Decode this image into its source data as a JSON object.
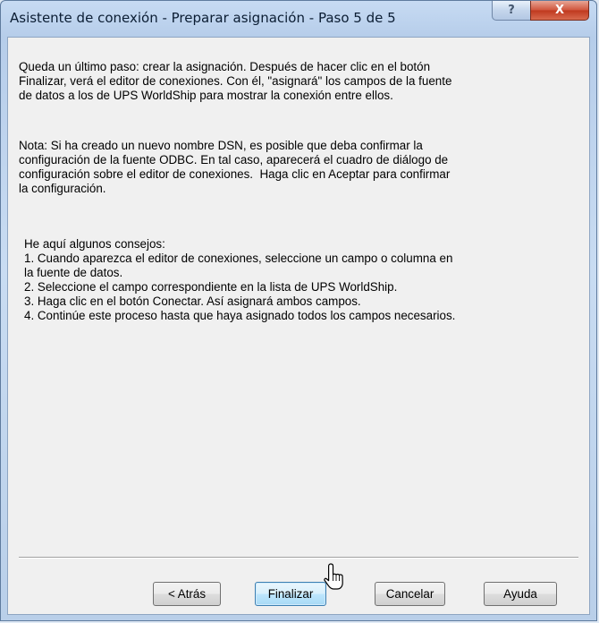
{
  "window": {
    "title": "Asistente de conexión - Preparar asignación - Paso 5 de 5",
    "help_button": "?",
    "close_button": "X"
  },
  "content": {
    "paragraph1": "Queda un último paso: crear la asignación. Después de hacer clic en el botón\nFinalizar, verá el editor de conexiones. Con él, \"asignará\" los campos de la fuente\nde datos a los de UPS WorldShip para mostrar la conexión entre ellos.",
    "paragraph2": "Nota: Si ha creado un nuevo nombre DSN, es posible que deba confirmar la\nconfiguración de la fuente ODBC. En tal caso, aparecerá el cuadro de diálogo de\nconfiguración sobre el editor de conexiones.  Haga clic en Aceptar para confirmar\nla configuración.",
    "tips": "He aquí algunos consejos:\n1. Cuando aparezca el editor de conexiones, seleccione un campo o columna en\nla fuente de datos.\n2. Seleccione el campo correspondiente en la lista de UPS WorldShip.\n3. Haga clic en el botón Conectar. Así asignará ambos campos.\n4. Continúe este proceso hasta que haya asignado todos los campos necesarios."
  },
  "buttons": {
    "back": "< Atrás",
    "finish": "Finalizar",
    "cancel": "Cancelar",
    "help": "Ayuda"
  },
  "icons": {
    "cursor": "pointer-cursor-icon"
  }
}
